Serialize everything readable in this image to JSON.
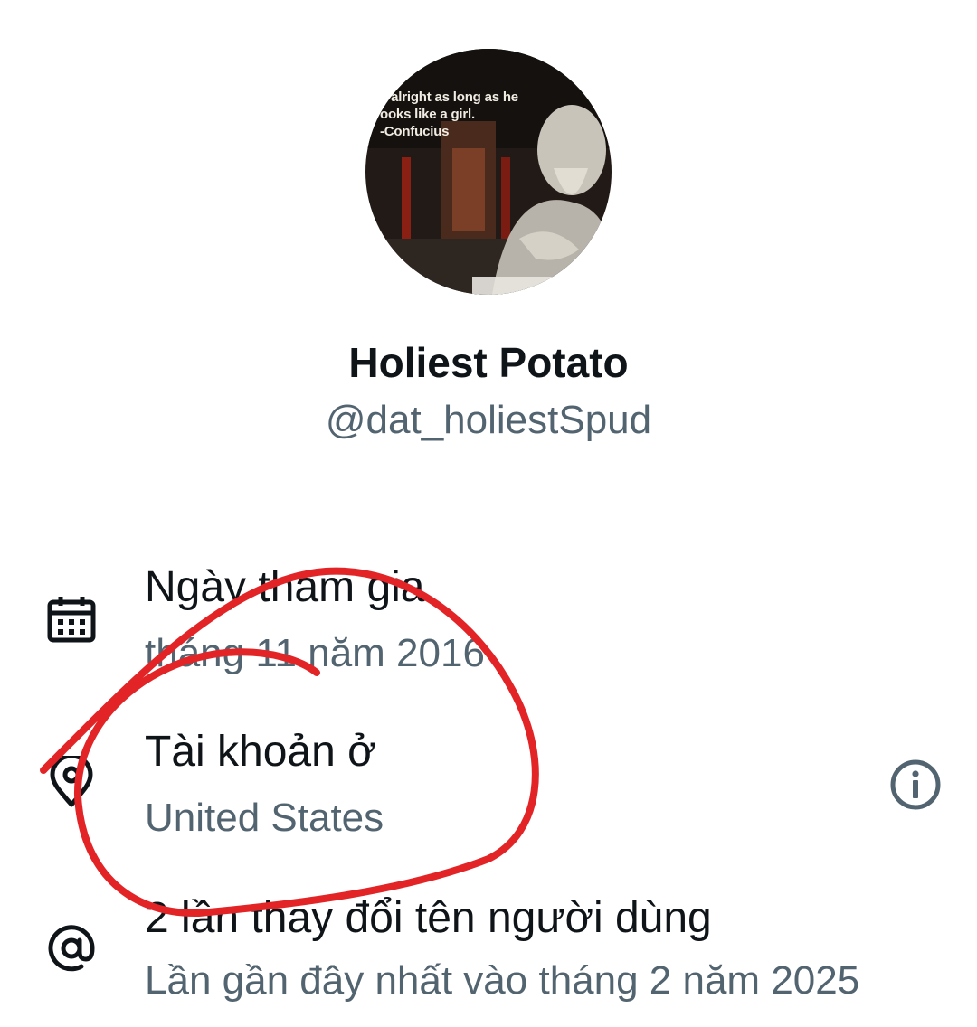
{
  "profile": {
    "display_name": "Holiest Potato",
    "handle": "@dat_holiestSpud",
    "avatar": {
      "icon": "confucius-meme-avatar",
      "quote_text": "s alright as long as he\nooks like a girl.\n-Confucius"
    }
  },
  "details": [
    {
      "icon": "calendar-icon",
      "title": "Ngày tham gia",
      "value": "tháng 11 năm 2016"
    },
    {
      "icon": "location-pin-icon",
      "title": "Tài khoản ở",
      "value": "United States",
      "action_icon": "info-icon"
    },
    {
      "icon": "at-sign-icon",
      "title": "2 lần thay đổi tên người dùng",
      "value": "Lần gần đây nhất vào tháng 2 năm 2025"
    }
  ],
  "colors": {
    "primary_text": "#0f1419",
    "secondary_text": "#536471",
    "annotation": "#e32427"
  }
}
